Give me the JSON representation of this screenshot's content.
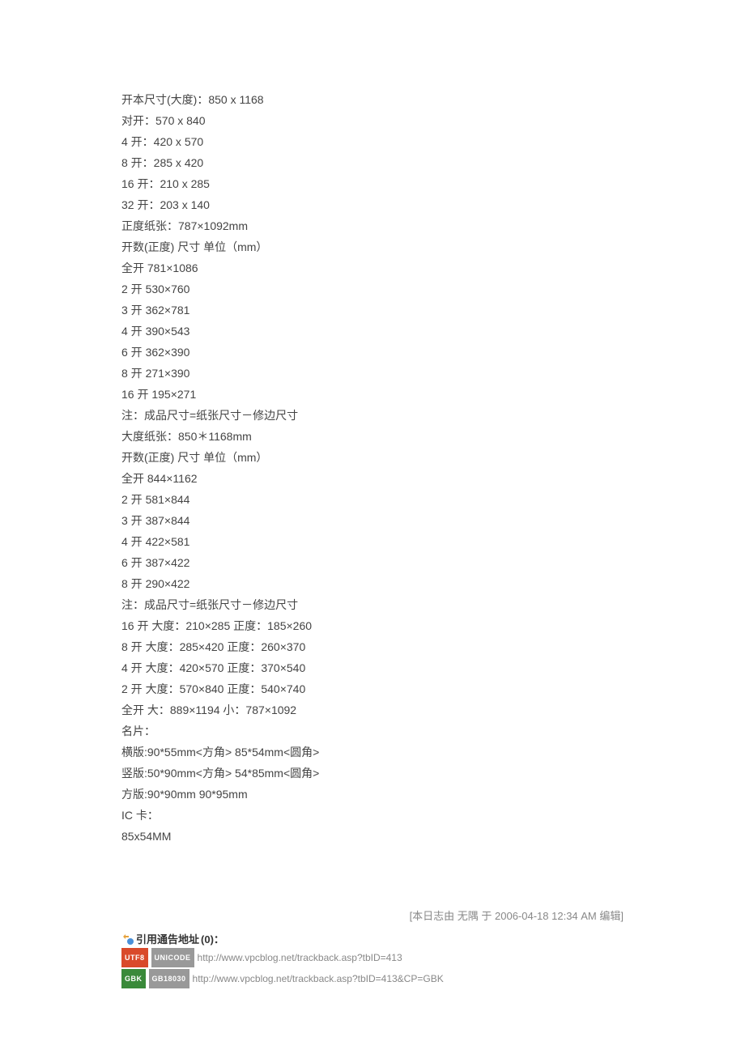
{
  "content_lines": [
    "开本尺寸(大度)：850 x 1168",
    "对开：570 x 840",
    "4 开：420 x 570",
    "8 开：285 x 420",
    "16 开：210 x 285",
    "32 开：203 x 140",
    "正度纸张：787×1092mm",
    "开数(正度) 尺寸 单位（mm）",
    "全开 781×1086",
    "2 开 530×760",
    "3 开 362×781",
    "4 开 390×543",
    "6 开 362×390",
    "8 开 271×390",
    "16 开 195×271",
    "注：成品尺寸=纸张尺寸－修边尺寸",
    "大度纸张：850＊1168mm",
    "开数(正度) 尺寸 单位（mm）",
    "全开 844×1162",
    "2 开 581×844",
    "3 开 387×844",
    "4 开 422×581",
    "6 开 387×422",
    "8 开 290×422",
    "注：成品尺寸=纸张尺寸－修边尺寸",
    "16 开 大度：210×285 正度：185×260",
    "8 开 大度：285×420 正度：260×370",
    "4 开 大度：420×570 正度：370×540",
    "2 开 大度：570×840 正度：540×740",
    "全开 大：889×1194 小：787×1092",
    "名片：",
    "横版:90*55mm<方角> 85*54mm<圆角>",
    "竖版:50*90mm<方角> 54*85mm<圆角>",
    "方版:90*90mm 90*95mm",
    "IC 卡：",
    "85x54MM"
  ],
  "edit_note": "[本日志由  无隅  于  2006-04-18 12:34 AM  编辑]",
  "trackback": {
    "header_label": "引用通告地址",
    "count_label": " (0)：",
    "rows": [
      {
        "badge1": {
          "text": "UTF8",
          "class": "badge-red"
        },
        "badge2": {
          "text": "UNICODE",
          "class": "badge-gray"
        },
        "url": "http://www.vpcblog.net/trackback.asp?tbID=413"
      },
      {
        "badge1": {
          "text": "GBK",
          "class": "badge-green"
        },
        "badge2": {
          "text": "GB18030",
          "class": "badge-gray"
        },
        "url": "http://www.vpcblog.net/trackback.asp?tbID=413&CP=GBK"
      }
    ]
  }
}
